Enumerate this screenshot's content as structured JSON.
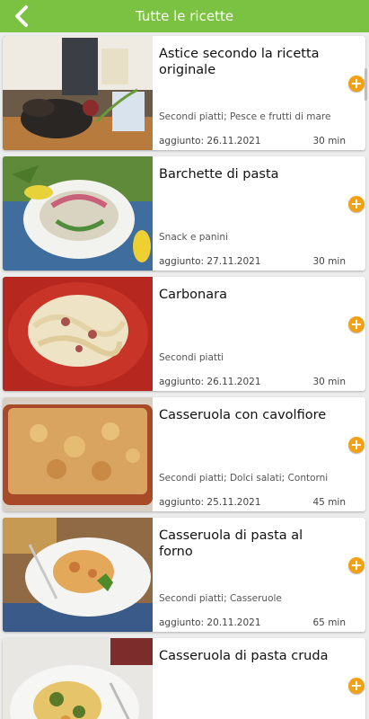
{
  "header": {
    "title": "Tutte le ricette",
    "back_icon": "chevron-left-icon"
  },
  "recipes": [
    {
      "title": "Astice secondo la ricetta originale",
      "category": "Secondi piatti; Pesce e frutti di mare",
      "added": "aggiunto: 26.11.2021",
      "time": "30 min"
    },
    {
      "title": "Barchette di pasta",
      "category": "Snack e panini",
      "added": "aggiunto: 27.11.2021",
      "time": "30 min"
    },
    {
      "title": "Carbonara",
      "category": "Secondi piatti",
      "added": "aggiunto: 26.11.2021",
      "time": "30 min"
    },
    {
      "title": "Casseruola con cavolfiore",
      "category": "Secondi piatti; Dolci salati; Contorni",
      "added": "aggiunto: 25.11.2021",
      "time": "45 min"
    },
    {
      "title": "Casseruola di pasta al forno",
      "category": "Secondi piatti; Casseruole",
      "added": "aggiunto: 20.11.2021",
      "time": "65 min"
    },
    {
      "title": "Casseruola di pasta cruda",
      "category": "",
      "added": "",
      "time": ""
    }
  ],
  "add_button": {
    "symbol": "+"
  },
  "colors": {
    "appbar": "#7cc242",
    "add_button": "#f2a117"
  }
}
